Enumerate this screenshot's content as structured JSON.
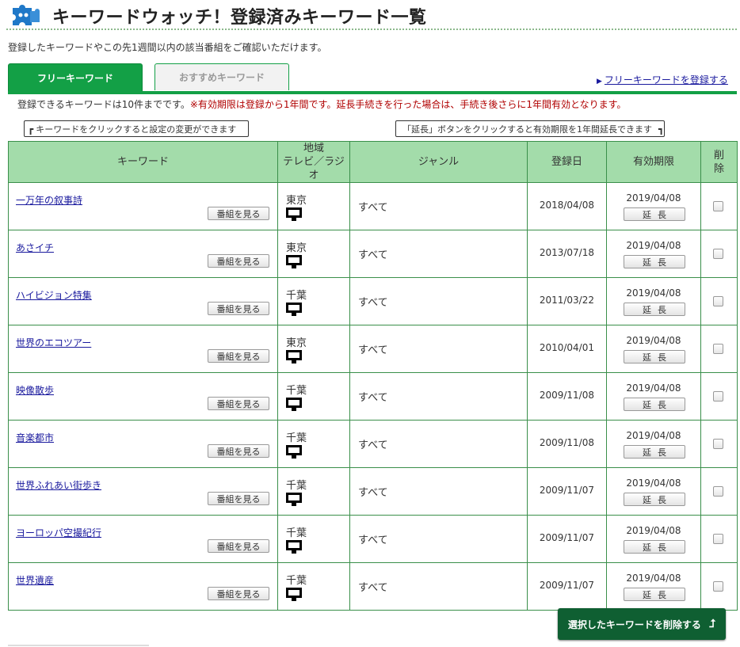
{
  "header": {
    "title": "キーワードウォッチ！登録済みキーワード一覧",
    "logo_icon": "puzzle-icon",
    "logo_color": "#1f78c8"
  },
  "subtitle": "登録したキーワードやこの先1週間以内の該当番組をご確認いただけます。",
  "tabs": {
    "free": "フリーキーワード",
    "recommend": "おすすめキーワード"
  },
  "register_link": "フリーキーワードを登録する",
  "notice": {
    "normal": "登録できるキーワードは10件までです。",
    "red": "※有効期限は登録から1年間です。延長手続きを行った場合は、手続き後さらに1年間有効となります。"
  },
  "hints": {
    "left": "キーワードをクリックすると設定の変更ができます",
    "right": "「延長」ボタンをクリックすると有効期限を1年間延長できます"
  },
  "table": {
    "headers": {
      "keyword": "キーワード",
      "area_line1": "地域",
      "area_line2": "テレビ／ラジオ",
      "genre": "ジャンル",
      "registered": "登録日",
      "expires": "有効期限",
      "delete_line1": "削",
      "delete_line2": "除"
    },
    "watch_label": "番組を見る",
    "extend_label": "延長",
    "rows": [
      {
        "keyword": "一万年の叙事詩",
        "area": "東京",
        "media_icon": "tv-icon",
        "genre": "すべて",
        "registered": "2018/04/08",
        "expires": "2019/04/08",
        "checked": false
      },
      {
        "keyword": "あさイチ",
        "area": "東京",
        "media_icon": "tv-icon",
        "genre": "すべて",
        "registered": "2013/07/18",
        "expires": "2019/04/08",
        "checked": false
      },
      {
        "keyword": "ハイビジョン特集",
        "area": "千葉",
        "media_icon": "tv-icon",
        "genre": "すべて",
        "registered": "2011/03/22",
        "expires": "2019/04/08",
        "checked": false
      },
      {
        "keyword": "世界のエコツアー",
        "area": "東京",
        "media_icon": "tv-icon",
        "genre": "すべて",
        "registered": "2010/04/01",
        "expires": "2019/04/08",
        "checked": false
      },
      {
        "keyword": "映像散歩",
        "area": "千葉",
        "media_icon": "tv-icon",
        "genre": "すべて",
        "registered": "2009/11/08",
        "expires": "2019/04/08",
        "checked": false
      },
      {
        "keyword": "音楽都市",
        "area": "千葉",
        "media_icon": "tv-icon",
        "genre": "すべて",
        "registered": "2009/11/08",
        "expires": "2019/04/08",
        "checked": false
      },
      {
        "keyword": "世界ふれあい街歩き",
        "area": "千葉",
        "media_icon": "tv-icon",
        "genre": "すべて",
        "registered": "2009/11/07",
        "expires": "2019/04/08",
        "checked": false
      },
      {
        "keyword": "ヨーロッパ空撮紀行",
        "area": "千葉",
        "media_icon": "tv-icon",
        "genre": "すべて",
        "registered": "2009/11/07",
        "expires": "2019/04/08",
        "checked": false
      },
      {
        "keyword": "世界遺産",
        "area": "千葉",
        "media_icon": "tv-icon",
        "genre": "すべて",
        "registered": "2009/11/07",
        "expires": "2019/04/08",
        "checked": false
      }
    ]
  },
  "delete_button": "選択したキーワードを削除する",
  "colors": {
    "accent_green": "#13a046",
    "header_green": "#a3dcaa",
    "dark_button": "#0f5f32",
    "link_blue": "#1a1a9e",
    "warning_red": "#b00000"
  }
}
